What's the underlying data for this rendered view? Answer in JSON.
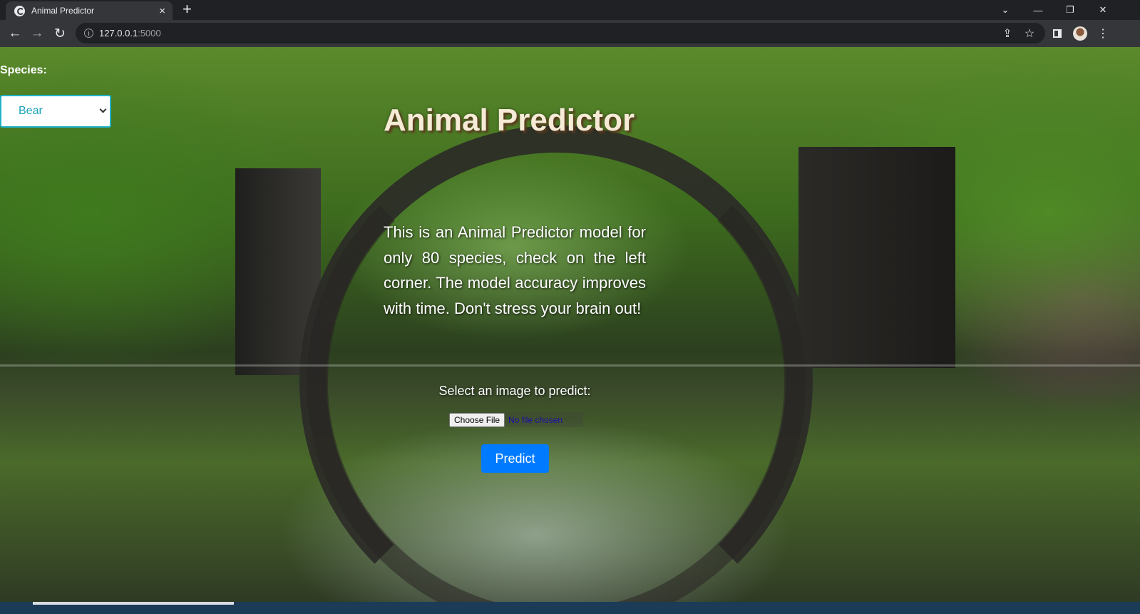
{
  "browser": {
    "tab_title": "Animal Predictor",
    "tab_close": "×",
    "new_tab": "+",
    "url_host": "127.0.0.1",
    "url_port": ":5000",
    "window_controls": {
      "dropdown": "⌄",
      "minimize": "—",
      "restore": "❐",
      "close": "✕"
    },
    "nav_icons": {
      "back": "←",
      "forward": "→",
      "reload": "↻"
    },
    "toolbar_icons": {
      "share": "⇪",
      "bookmark": "☆",
      "menu": "⋮"
    }
  },
  "page": {
    "species_label": "Species:",
    "species_selected": "Bear",
    "title": "Animal Predictor",
    "intro": "This is an Animal Predictor model for only 80 species, check on the left corner. The model accuracy improves with time. Don't stress your brain out!",
    "select_label": "Select an image to predict:",
    "file_button": "Choose File",
    "file_status": "No file chosen",
    "predict_button": "Predict"
  },
  "colors": {
    "predict_button": "#007bff",
    "select_border": "#20b2c8",
    "select_text": "#17a2b8",
    "title_text": "#f5ebd6"
  }
}
